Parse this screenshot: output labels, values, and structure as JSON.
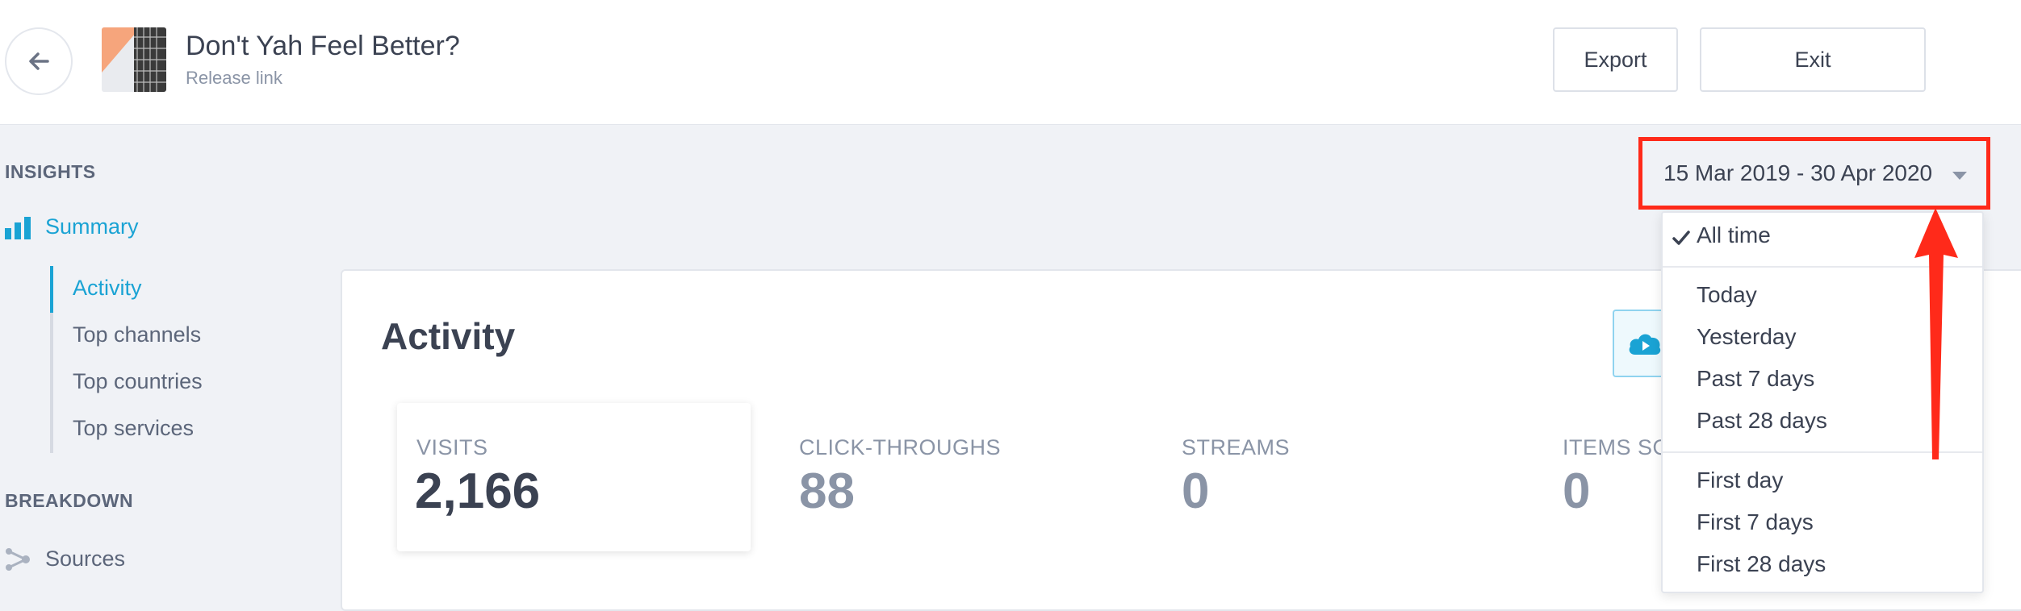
{
  "header": {
    "back_icon": "arrow-left-icon",
    "title": "Don't Yah Feel Better?",
    "subtitle": "Release link",
    "export_label": "Export",
    "exit_label": "Exit"
  },
  "sidebar": {
    "insights_title": "INSIGHTS",
    "summary_label": "Summary",
    "summary_icon": "bar-chart-icon",
    "summary_items": [
      {
        "label": "Activity",
        "active": true
      },
      {
        "label": "Top channels",
        "active": false
      },
      {
        "label": "Top countries",
        "active": false
      },
      {
        "label": "Top services",
        "active": false
      }
    ],
    "breakdown_title": "BREAKDOWN",
    "sources_label": "Sources",
    "sources_icon": "share-nodes-icon"
  },
  "main": {
    "card_title": "Activity",
    "cloud_icon": "cloud-play-icon",
    "stats": [
      {
        "label": "VISITS",
        "value": "2,166"
      },
      {
        "label": "CLICK-THROUGHS",
        "value": "88"
      },
      {
        "label": "STREAMS",
        "value": "0"
      },
      {
        "label": "ITEMS SO",
        "value": "0"
      }
    ]
  },
  "date_filter": {
    "selected_range": "15 Mar 2019 - 30 Apr 2020",
    "options": {
      "all_time": "All time",
      "today": "Today",
      "yesterday": "Yesterday",
      "past_7": "Past 7 days",
      "past_28": "Past 28 days",
      "first_day": "First day",
      "first_7": "First 7 days",
      "first_28": "First 28 days"
    }
  },
  "colors": {
    "accent": "#1aa3d4",
    "annotation": "#ff2a1a"
  }
}
